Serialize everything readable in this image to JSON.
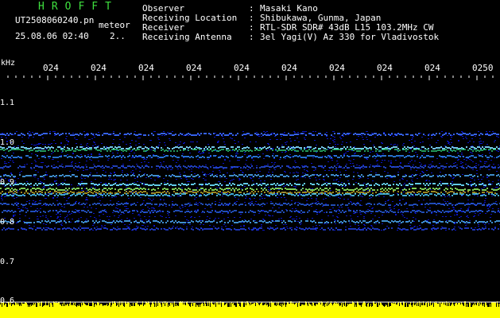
{
  "header": {
    "app_name": "HROFFT",
    "filename": "UT2508060240.pn",
    "meteor_label": "meteor",
    "datetime": "25.08.06 02:40",
    "count": "2..",
    "info": [
      {
        "label": "Observer",
        "value": "Masaki Kano"
      },
      {
        "label": "Receiving Location",
        "value": "Shibukawa, Gunma, Japan"
      },
      {
        "label": "Receiver",
        "value": "RTL-SDR SDR# 43dB L15 103.2MHz CW"
      },
      {
        "label": "Receiving Antenna",
        "value": "3el Yagi(V) Az 330 for Vladivostok"
      }
    ]
  },
  "axis": {
    "unit": "kHz",
    "time_ticks": [
      "024",
      "024",
      "024",
      "024",
      "024",
      "024",
      "024",
      "024",
      "024",
      "0250"
    ],
    "freq_labels": [
      "1.1",
      "1.0",
      "0.9",
      "0.8",
      "0.7",
      "0.6"
    ]
  },
  "colors": {
    "background": "#000000",
    "tick": "#ffffff",
    "title": "#3fe03f",
    "amplitude": "#ffff00",
    "noise_floor": "#0000aa"
  }
}
